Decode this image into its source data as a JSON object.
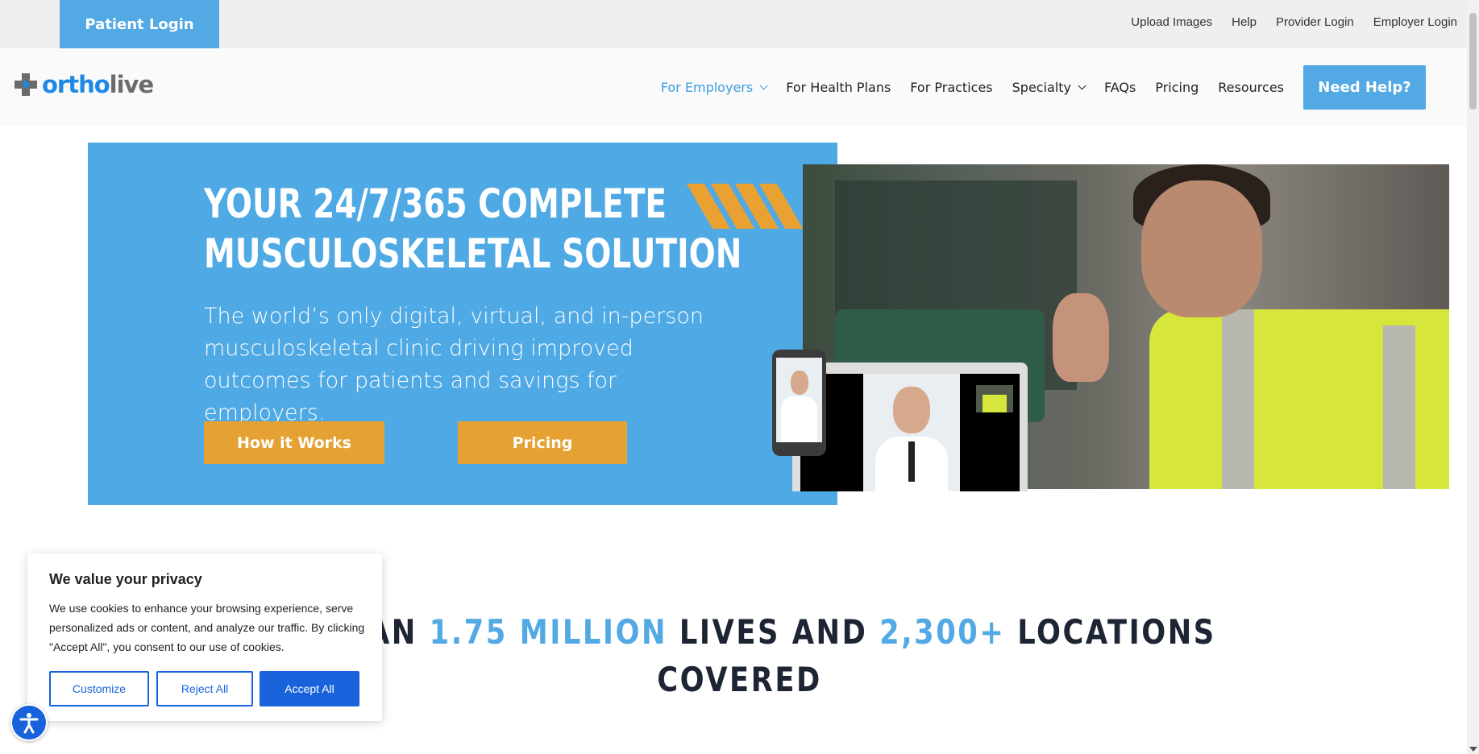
{
  "topbar": {
    "patient_login": "Patient Login",
    "links": [
      "Upload Images",
      "Help",
      "Provider Login",
      "Employer Login"
    ]
  },
  "header": {
    "logo": {
      "part1": "ortho",
      "part2": "live"
    },
    "nav": [
      {
        "label": "For Employers",
        "dropdown": true,
        "active": true
      },
      {
        "label": "For Health Plans"
      },
      {
        "label": "For Practices"
      },
      {
        "label": "Specialty",
        "dropdown": true
      },
      {
        "label": "FAQs"
      },
      {
        "label": "Pricing"
      },
      {
        "label": "Resources"
      }
    ],
    "cta": "Need Help?"
  },
  "hero": {
    "title_line1": "YOUR 24/7/365 COMPLETE",
    "title_line2": "MUSCULOSKELETAL SOLUTION",
    "subtitle": "The world’s only digital, virtual, and in-person musculoskeletal clinic driving improved outcomes for patients and savings for employers.",
    "btn_how": "How it Works",
    "btn_pricing": "Pricing"
  },
  "stats": {
    "pre": "RE THAN ",
    "lives_value": "1.75 MILLION",
    "mid": " LIVES AND ",
    "locations_value": "2,300+",
    "post": " LOCATIONS",
    "line2": "COVERED"
  },
  "cookie": {
    "title": "We value your privacy",
    "body": "We use cookies to enhance your browsing experience, serve personalized ads or content, and analyze our traffic. By clicking \"Accept All\", you consent to our use of cookies.",
    "customize": "Customize",
    "reject": "Reject All",
    "accept": "Accept All"
  },
  "colors": {
    "brand_blue": "#52a9e3",
    "accent_orange": "#e6a133",
    "cookie_blue": "#1863dc",
    "dark_text": "#1d2433"
  },
  "icons": [
    "chevron-down-icon",
    "accessibility-icon",
    "logo-cross-icon"
  ]
}
